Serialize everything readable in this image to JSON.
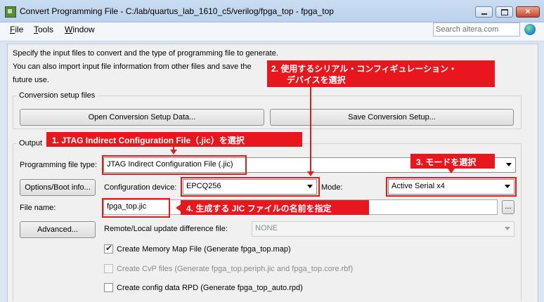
{
  "window": {
    "title": "Convert Programming File - C:/lab/quartus_lab_1610_c5/verilog/fpga_top - fpga_top",
    "close_label": "×"
  },
  "menu": [
    {
      "label_first": "F",
      "label_rest": "ile"
    },
    {
      "label_first": "T",
      "label_rest": "ools"
    },
    {
      "label_first": "W",
      "label_rest": "indow"
    }
  ],
  "search": {
    "placeholder": "Search altera.com"
  },
  "intro": {
    "line1": "Specify the input files to convert and the type of programming file to generate.",
    "line2": "You can also import input file information from other files and save the",
    "line3": "future use."
  },
  "conversion_setup": {
    "title": "Conversion setup files",
    "open_button": "Open Conversion Setup Data...",
    "save_button": "Save Conversion Setup..."
  },
  "output_group": {
    "title": "Output"
  },
  "programming_file_type": {
    "label": "Programming file type:",
    "value": "JTAG Indirect Configuration File (.jic)"
  },
  "options_boot_button": "Options/Boot info...",
  "configuration_device": {
    "label": "Configuration device:",
    "value": "EPCQ256"
  },
  "mode": {
    "label": "Mode:",
    "value": "Active Serial x4"
  },
  "file_name": {
    "label": "File name:",
    "value": "fpga_top.jic",
    "browse_label": "..."
  },
  "advanced_button": "Advanced...",
  "remote_local": {
    "label": "Remote/Local update difference file:",
    "value": "NONE"
  },
  "checkboxes": [
    {
      "label": "Create Memory Map File (Generate fpga_top.map)",
      "checked": true,
      "enabled": true,
      "mark": "✔"
    },
    {
      "label": "Create CvP files (Generate fpga_top.periph.jic and fpga_top.core.rbf)",
      "checked": false,
      "enabled": false
    },
    {
      "label": "Create config data RPD (Generate fpga_top_auto.rpd)",
      "checked": false,
      "enabled": true
    }
  ],
  "annotations": {
    "step1": "1. JTAG Indirect Configuration File（.jic）を選択",
    "step2_line1": "2. 使用するシリアル・コンフィギュレーション・",
    "step2_line2": "デバイスを選択",
    "step3": "3. モードを選択",
    "step4": "4. 生成する JIC ファイルの名前を指定",
    "color": "#e8161d"
  }
}
